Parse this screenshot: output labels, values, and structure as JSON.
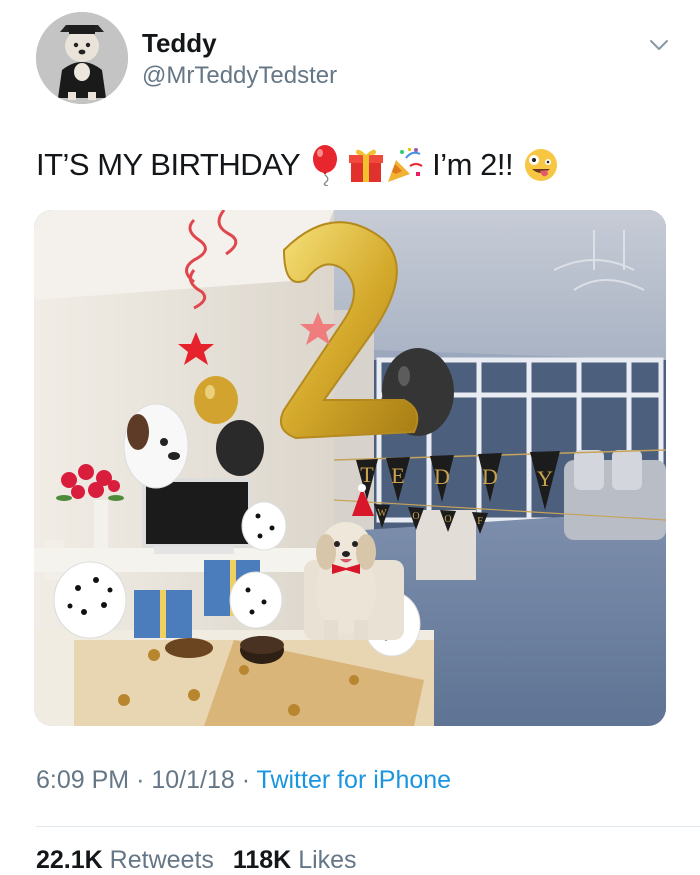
{
  "user": {
    "name": "Teddy",
    "handle": "@MrTeddyTedster"
  },
  "tweet": {
    "text_before": "IT’S MY BIRTHDAY",
    "text_after": "I’m 2!!",
    "emojis": [
      "balloon-emoji",
      "gift-emoji",
      "party-popper-emoji",
      "zany-face-emoji"
    ]
  },
  "photo": {
    "banner_letters": [
      "T",
      "E",
      "D",
      "D",
      "Y"
    ],
    "lower_letters": [
      "W",
      "O",
      "O",
      "F"
    ],
    "number_balloon": "2"
  },
  "meta": {
    "time": "6:09 PM",
    "date": "10/1/18",
    "separator": "·",
    "source": "Twitter for iPhone"
  },
  "stats": {
    "retweets_count": "22.1K",
    "retweets_label": "Retweets",
    "likes_count": "118K",
    "likes_label": "Likes"
  },
  "colors": {
    "link": "#1b95e0",
    "secondary_text": "#657786",
    "primary_text": "#14171a"
  }
}
